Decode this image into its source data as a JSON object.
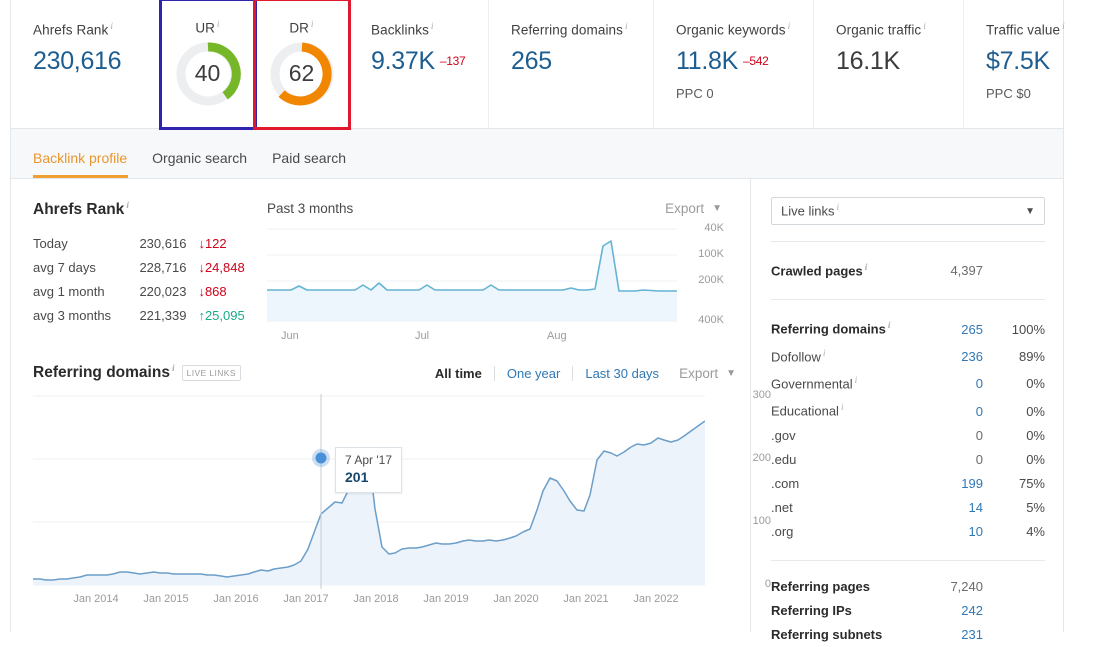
{
  "metrics": [
    {
      "key": "ahrefs_rank",
      "label": "Ahrefs Rank",
      "value": "230,616",
      "delta": "",
      "sub": "",
      "value_color": "blue"
    },
    {
      "key": "ur",
      "label": "UR",
      "value": "40",
      "gauge_pct": 40,
      "gauge_color": "#76b72a",
      "highlight": "blue"
    },
    {
      "key": "dr",
      "label": "DR",
      "value": "62",
      "gauge_pct": 62,
      "gauge_color": "#f18700",
      "highlight": "red"
    },
    {
      "key": "backlinks",
      "label": "Backlinks",
      "value": "9.37K",
      "delta": "–137",
      "sub": "",
      "value_color": "blue"
    },
    {
      "key": "referring_domains",
      "label": "Referring domains",
      "value": "265",
      "delta": "",
      "sub": "",
      "value_color": "blue"
    },
    {
      "key": "organic_keywords",
      "label": "Organic keywords",
      "value": "11.8K",
      "delta": "–542",
      "sub": "PPC 0",
      "value_color": "blue"
    },
    {
      "key": "organic_traffic",
      "label": "Organic traffic",
      "value": "16.1K",
      "delta": "",
      "sub": "",
      "value_color": "dark"
    },
    {
      "key": "traffic_value",
      "label": "Traffic value",
      "value": "$7.5K",
      "delta": "",
      "sub": "PPC $0",
      "value_color": "blue"
    }
  ],
  "tabs": [
    {
      "label": "Backlink profile",
      "active": true
    },
    {
      "label": "Organic search",
      "active": false
    },
    {
      "label": "Paid search",
      "active": false
    }
  ],
  "ahrefs_rank": {
    "title": "Ahrefs Rank",
    "rows": [
      {
        "name": "Today",
        "value": "230,616",
        "change": "122",
        "dir": "down"
      },
      {
        "name": "avg 7 days",
        "value": "228,716",
        "change": "24,848",
        "dir": "down"
      },
      {
        "name": "avg 1 month",
        "value": "220,023",
        "change": "868",
        "dir": "down"
      },
      {
        "name": "avg 3 months",
        "value": "221,339",
        "change": "25,095",
        "dir": "up"
      }
    ]
  },
  "mini_chart_header": {
    "title": "Past 3 months",
    "export": "Export"
  },
  "referring_domains_section": {
    "title": "Referring domains",
    "badge": "LIVE LINKS",
    "ranges": [
      {
        "label": "All time",
        "active": true
      },
      {
        "label": "One year",
        "active": false
      },
      {
        "label": "Last 30 days",
        "active": false
      }
    ],
    "export": "Export",
    "tooltip": {
      "date": "7 Apr '17",
      "value": "201"
    }
  },
  "sidebar": {
    "select_label": "Live links",
    "crawled": {
      "label": "Crawled pages",
      "value": "4,397"
    },
    "rows": [
      {
        "label": "Referring domains",
        "value": "265",
        "pct": "100%",
        "bold": true,
        "info": true
      },
      {
        "label": "Dofollow",
        "value": "236",
        "pct": "89%",
        "bold": false,
        "info": true
      },
      {
        "label": "Governmental",
        "value": "0",
        "pct": "0%",
        "bold": false,
        "info": true
      },
      {
        "label": "Educational",
        "value": "0",
        "pct": "0%",
        "bold": false,
        "info": true
      },
      {
        "label": ".gov",
        "value": "0",
        "pct": "0%",
        "bold": false,
        "info": false
      },
      {
        "label": ".edu",
        "value": "0",
        "pct": "0%",
        "bold": false,
        "info": false
      },
      {
        "label": ".com",
        "value": "199",
        "pct": "75%",
        "bold": false,
        "info": false
      },
      {
        "label": ".net",
        "value": "14",
        "pct": "5%",
        "bold": false,
        "info": false
      },
      {
        "label": ".org",
        "value": "10",
        "pct": "4%",
        "bold": false,
        "info": false
      }
    ],
    "totals": [
      {
        "label": "Referring pages",
        "value": "7,240",
        "grey": true
      },
      {
        "label": "Referring IPs",
        "value": "242",
        "grey": false
      },
      {
        "label": "Referring subnets",
        "value": "231",
        "grey": false
      }
    ]
  },
  "chart_data": [
    {
      "id": "past_3_months",
      "type": "line",
      "title": "Past 3 months",
      "xlabel": "",
      "ylabel": "Ahrefs Rank",
      "inverted_y": true,
      "ytick_labels": [
        "40K",
        "100K",
        "200K",
        "400K"
      ],
      "ylim": [
        400000,
        40000
      ],
      "xtick_labels": [
        "Jun",
        "Jul",
        "Aug"
      ],
      "note": "Rank axis inverted: lower rank number (better) plots higher.",
      "x": [
        0,
        2,
        4,
        6,
        8,
        10,
        12,
        14,
        16,
        18,
        20,
        22,
        24,
        26,
        28,
        30,
        32,
        34,
        36,
        38,
        40,
        42,
        44,
        46,
        48,
        50,
        52,
        54,
        56,
        58,
        60,
        62,
        64,
        66,
        68,
        70,
        72,
        74,
        76,
        78,
        80,
        82,
        84,
        86,
        88,
        90,
        92,
        94,
        96,
        98,
        100
      ],
      "values": [
        225000,
        225000,
        225000,
        225000,
        224000,
        225000,
        216000,
        225000,
        224000,
        225000,
        225000,
        224000,
        212000,
        225000,
        208000,
        224000,
        225000,
        225000,
        225000,
        214000,
        225000,
        225000,
        225000,
        225000,
        225000,
        214000,
        225000,
        225000,
        225000,
        225000,
        225000,
        225000,
        226000,
        226000,
        219000,
        226000,
        226000,
        226000,
        226000,
        224000,
        150000,
        95000,
        45000,
        43000,
        230000,
        229000,
        229000,
        227000,
        228000,
        229000,
        229000
      ]
    },
    {
      "id": "referring_domains_all_time",
      "type": "area",
      "title": "Referring domains",
      "xlabel": "",
      "ylabel": "Referring domains",
      "ylim": [
        0,
        300
      ],
      "ytick_labels": [
        "300",
        "200",
        "100",
        "0"
      ],
      "xtick_labels": [
        "Jan 2014",
        "Jan 2015",
        "Jan 2016",
        "Jan 2017",
        "Jan 2018",
        "Jan 2019",
        "Jan 2020",
        "Jan 2021",
        "Jan 2022"
      ],
      "annotation": {
        "date": "7 Apr '17",
        "value": 201
      },
      "x": [
        0,
        1,
        2,
        3,
        4,
        5,
        6,
        7,
        8,
        9,
        10,
        11,
        12,
        13,
        14,
        15,
        16,
        17,
        18,
        19,
        20,
        21,
        22,
        23,
        24,
        25,
        26,
        27,
        28,
        29,
        30,
        31,
        32,
        33,
        34,
        35,
        36,
        37,
        38,
        39,
        40,
        41,
        42,
        43,
        44,
        45,
        46,
        47,
        48,
        49,
        50,
        51,
        52,
        53,
        54,
        55,
        56,
        57,
        58,
        59,
        60,
        61,
        62,
        63,
        64,
        65,
        66,
        67,
        68,
        69,
        70,
        71,
        72,
        73,
        74,
        75,
        76,
        77,
        78,
        79,
        80,
        81,
        82,
        83,
        84,
        85,
        86,
        87,
        88,
        89,
        90,
        91,
        92,
        93,
        94,
        95,
        96,
        97,
        98,
        99,
        100
      ],
      "values": [
        9,
        9,
        8,
        8,
        9,
        9,
        10,
        12,
        16,
        15,
        15,
        16,
        18,
        20,
        20,
        19,
        18,
        19,
        21,
        20,
        19,
        18,
        18,
        18,
        17,
        17,
        16,
        16,
        14,
        13,
        14,
        15,
        18,
        20,
        23,
        22,
        24,
        26,
        27,
        30,
        36,
        55,
        85,
        110,
        120,
        130,
        128,
        150,
        175,
        195,
        201,
        120,
        60,
        50,
        52,
        60,
        62,
        62,
        64,
        68,
        66,
        66,
        67,
        70,
        72,
        70,
        70,
        71,
        70,
        72,
        74,
        78,
        80,
        86,
        120,
        150,
        170,
        165,
        150,
        135,
        120,
        118,
        145,
        200,
        215,
        210,
        205,
        215,
        225,
        230,
        228,
        232,
        245,
        240,
        235,
        240,
        250,
        260,
        270,
        282,
        290
      ]
    }
  ]
}
